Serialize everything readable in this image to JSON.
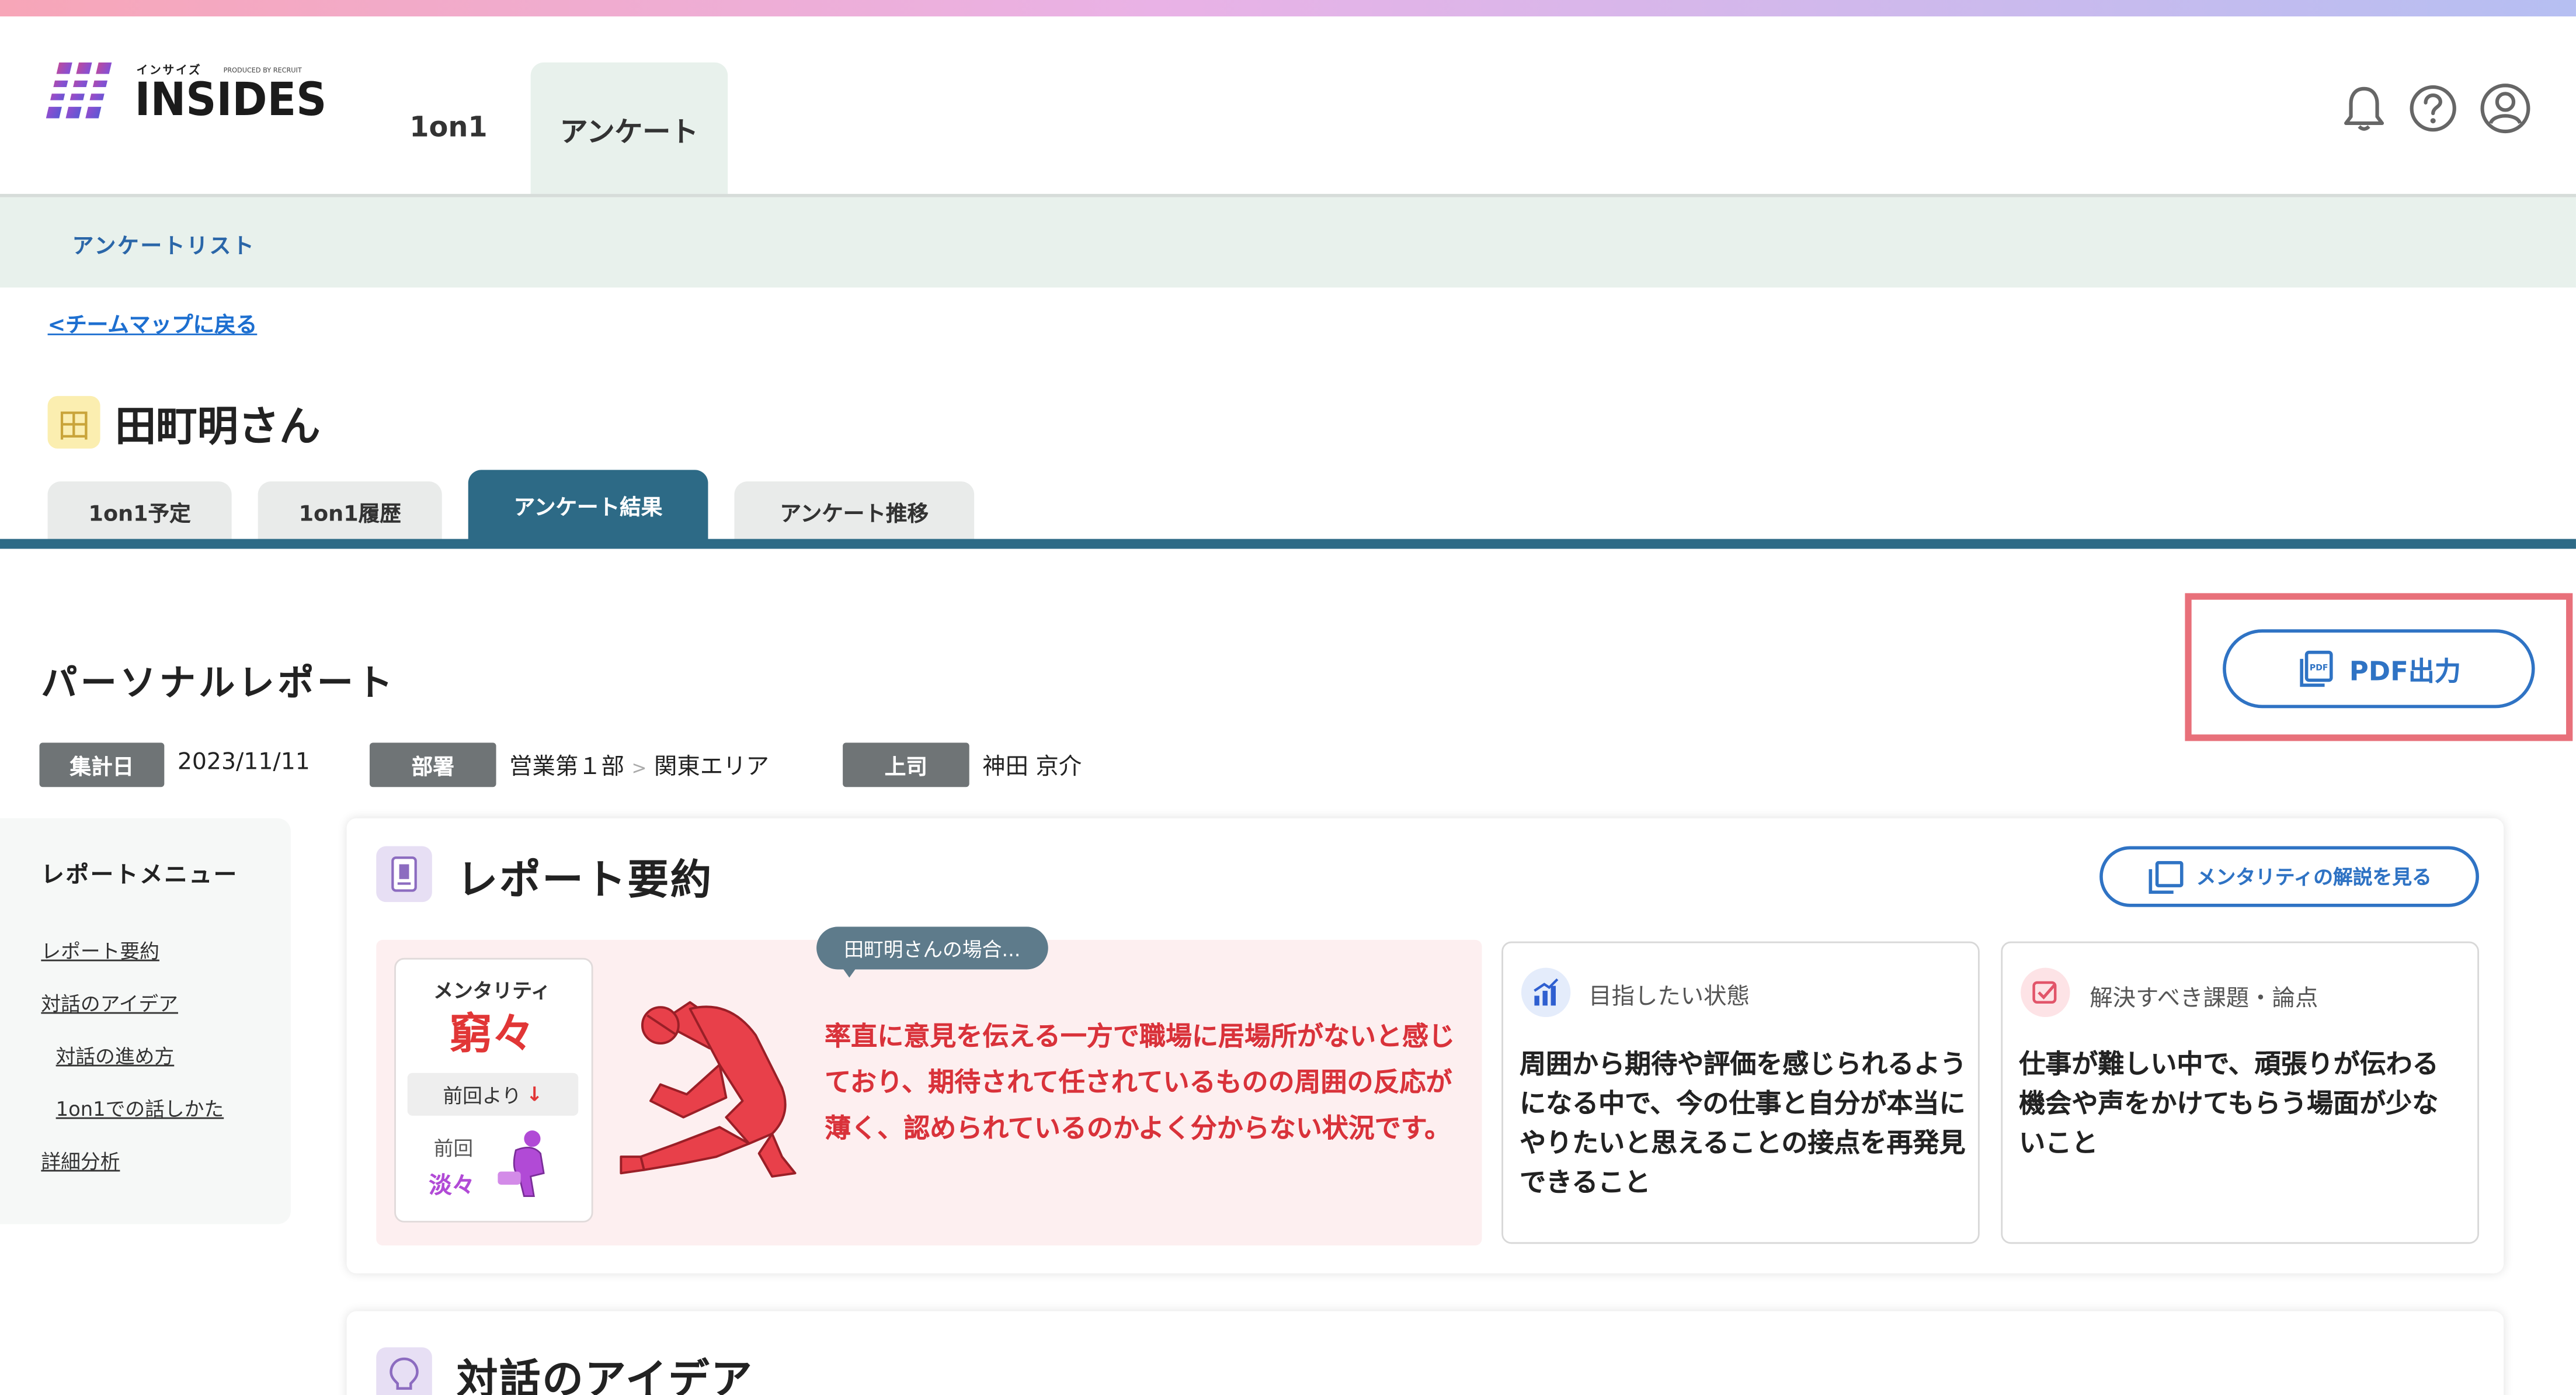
{
  "app": {
    "logo_ruby": "インサイズ",
    "logo_produced": "PRODUCED BY RECRUIT",
    "logo_word": "INSIDES"
  },
  "nav": {
    "tabs": [
      "1on1",
      "アンケート"
    ],
    "active_tab": "アンケート",
    "icons": [
      "bell-icon",
      "help-icon",
      "user-account-icon"
    ]
  },
  "subnav": {
    "link": "アンケートリスト"
  },
  "back_link": "<チームマップに戻る",
  "person": {
    "avatar_char": "田",
    "name": "田町明さん"
  },
  "person_tabs": {
    "items": [
      "1on1予定",
      "1on1履歴",
      "アンケート結果",
      "アンケート推移"
    ],
    "active": "アンケート結果"
  },
  "report": {
    "title": "パーソナルレポート",
    "pdf_button": "PDF出力",
    "meta": {
      "date_label": "集計日",
      "date_value": "2023/11/11",
      "dept_label": "部署",
      "dept_value_1": "営業第１部",
      "dept_sep": ">",
      "dept_value_2": "関東エリア",
      "boss_label": "上司",
      "boss_value": "神田 京介"
    }
  },
  "side_menu": {
    "title": "レポートメニュー",
    "items": [
      "レポート要約",
      "対話のアイデア",
      "対話の進め方",
      "1on1での話しかた",
      "詳細分析"
    ]
  },
  "summary_section": {
    "title": "レポート要約",
    "explain_button": "メンタリティの解説を見る",
    "mentality_label": "メンタリティ",
    "mentality_value": "窮々",
    "prev_change": "前回より",
    "prev_label": "前回",
    "prev_value": "淡々",
    "bubble": "田町明さんの場合...",
    "summary_text": "率直に意見を伝える一方で職場に居場所がないと感じており、期待されて任されているものの周囲の反応が薄く、認められているのかよく分からない状況です。",
    "goal_title": "目指したい状態",
    "goal_text": "周囲から期待や評価を感じられるようになる中で、今の仕事と自分が本当にやりたいと思えることの接点を再発見できること",
    "issue_title": "解決すべき課題・論点",
    "issue_text": "仕事が難しい中で、頑張りが伝わる機会や声をかけてもらう場面が少ないこと"
  },
  "ideas_section": {
    "title": "対話のアイデア"
  },
  "colors": {
    "accent_blue": "#2f73c4",
    "tab_active": "#2d6a86",
    "highlight_red": "#e8707a",
    "alert_red": "#d9323a"
  }
}
